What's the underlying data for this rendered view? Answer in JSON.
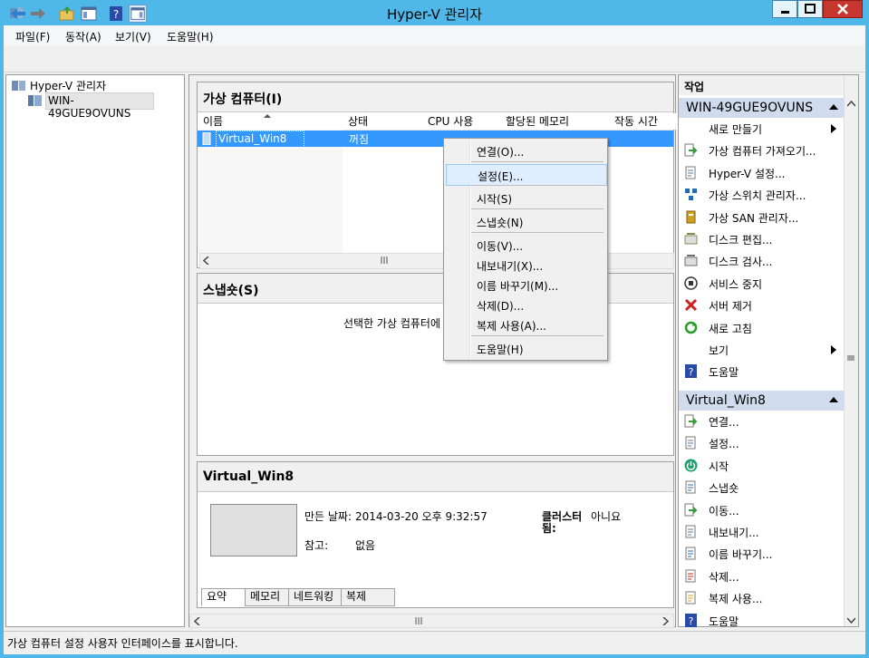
{
  "window": {
    "title": "Hyper-V 관리자"
  },
  "menu": {
    "file": "파일(F)",
    "action": "동작(A)",
    "view": "보기(V)",
    "help": "도움말(H)"
  },
  "tree": {
    "root": "Hyper-V 관리자",
    "server": "WIN-49GUE9OVUNS"
  },
  "vm_section": {
    "title": "가상 컴퓨터(I)",
    "columns": [
      "이름",
      "상태",
      "CPU 사용",
      "할당된 메모리",
      "작동 시간"
    ],
    "rows": [
      {
        "name": "Virtual_Win8",
        "state": "꺼짐"
      }
    ]
  },
  "snapshot_section": {
    "title": "스냅숏(S)",
    "message": "선택한 가상 컴퓨터에"
  },
  "details": {
    "title": "Virtual_Win8",
    "created_label": "만든 날짜:",
    "created_value": "2014-03-20 오후 9:32:57",
    "notes_label": "참고:",
    "notes_value": "없음",
    "cluster_label_1": "클러스터",
    "cluster_label_2": "됨:",
    "cluster_value": "아니요",
    "tabs": [
      "요약",
      "메모리",
      "네트워킹",
      "복제"
    ]
  },
  "context_menu": [
    "연결(O)...",
    "설정(E)...",
    "시작(S)",
    "스냅숏(N)",
    "이동(V)...",
    "내보내기(X)...",
    "이름 바꾸기(M)...",
    "삭제(D)...",
    "복제 사용(A)...",
    "도움말(H)"
  ],
  "actions": {
    "header": "작업",
    "server_group": {
      "title": "WIN-49GUE9OVUNS",
      "items": [
        "새로 만들기",
        "가상 컴퓨터 가져오기...",
        "Hyper-V 설정...",
        "가상 스위치 관리자...",
        "가상 SAN 관리자...",
        "디스크 편집...",
        "디스크 검사...",
        "서비스 중지",
        "서버 제거",
        "새로 고침",
        "보기",
        "도움말"
      ]
    },
    "vm_group": {
      "title": "Virtual_Win8",
      "items": [
        "연결...",
        "설정...",
        "시작",
        "스냅숏",
        "이동...",
        "내보내기...",
        "이름 바꾸기...",
        "삭제...",
        "복제 사용...",
        "도움말"
      ]
    }
  },
  "status": {
    "text": "가상 컴퓨터 설정 사용자 인터페이스를 표시합니다."
  },
  "colors": {
    "titlebar": "#4fb8e8",
    "selection": "#3399ff",
    "action_header": "#d0dcee"
  }
}
